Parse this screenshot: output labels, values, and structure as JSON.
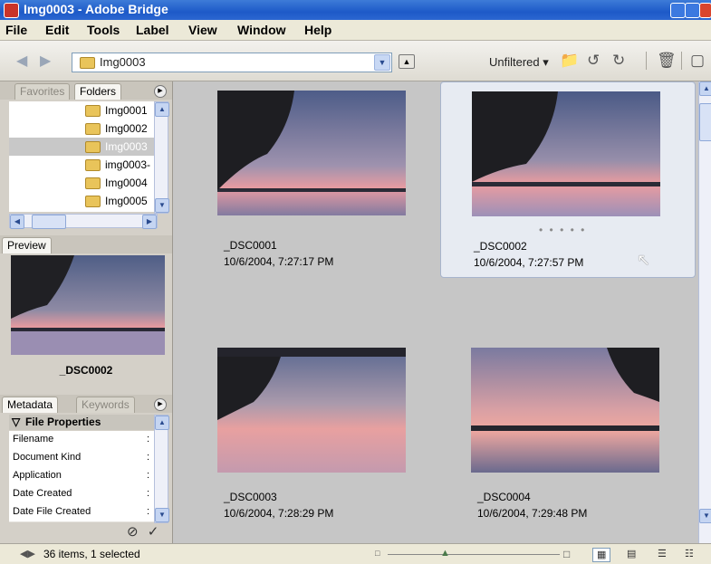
{
  "window": {
    "title": "Img0003 - Adobe Bridge"
  },
  "menu": [
    "File",
    "Edit",
    "Tools",
    "Label",
    "View",
    "Window",
    "Help"
  ],
  "toolbar": {
    "path": "Img0003",
    "filter": "Unfiltered ▾"
  },
  "left": {
    "tabs": {
      "favorites": "Favorites",
      "folders": "Folders"
    },
    "folders": [
      {
        "name": "Img0001",
        "selected": false
      },
      {
        "name": "Img0002",
        "selected": false
      },
      {
        "name": "Img0003",
        "selected": true
      },
      {
        "name": "img0003-",
        "selected": false
      },
      {
        "name": "Img0004",
        "selected": false
      },
      {
        "name": "Img0005",
        "selected": false
      }
    ],
    "preview_tab": "Preview",
    "preview_name": "_DSC0002",
    "meta_tabs": {
      "metadata": "Metadata",
      "keywords": "Keywords"
    },
    "file_properties": "File Properties",
    "meta_rows": [
      {
        "key": "Filename",
        "sep": ":"
      },
      {
        "key": "Document Kind",
        "sep": ":"
      },
      {
        "key": "Application",
        "sep": ":"
      },
      {
        "key": "Date Created",
        "sep": ":"
      },
      {
        "key": "Date File Created",
        "sep": ":"
      }
    ]
  },
  "thumbnails": [
    {
      "name": "_DSC0001",
      "date": "10/6/2004, 7:27:17 PM",
      "selected": false
    },
    {
      "name": "_DSC0002",
      "date": "10/6/2004, 7:27:57 PM",
      "selected": true,
      "dots": "• • • • •"
    },
    {
      "name": "_DSC0003",
      "date": "10/6/2004, 7:28:29 PM",
      "selected": false
    },
    {
      "name": "_DSC0004",
      "date": "10/6/2004, 7:29:48 PM",
      "selected": false
    }
  ],
  "status": {
    "text": "36 items, 1 selected"
  },
  "colors": {
    "titlebar": "#1d5ac8",
    "selection": "#c8c8c8",
    "content_bg": "#c6c6c6"
  },
  "icons": [
    "back-arrow-icon",
    "forward-arrow-icon",
    "folder-icon",
    "up-folder-icon",
    "new-folder-icon",
    "rotate-left-icon",
    "rotate-right-icon",
    "trash-icon",
    "compact-mode-icon",
    "cursor-icon"
  ]
}
